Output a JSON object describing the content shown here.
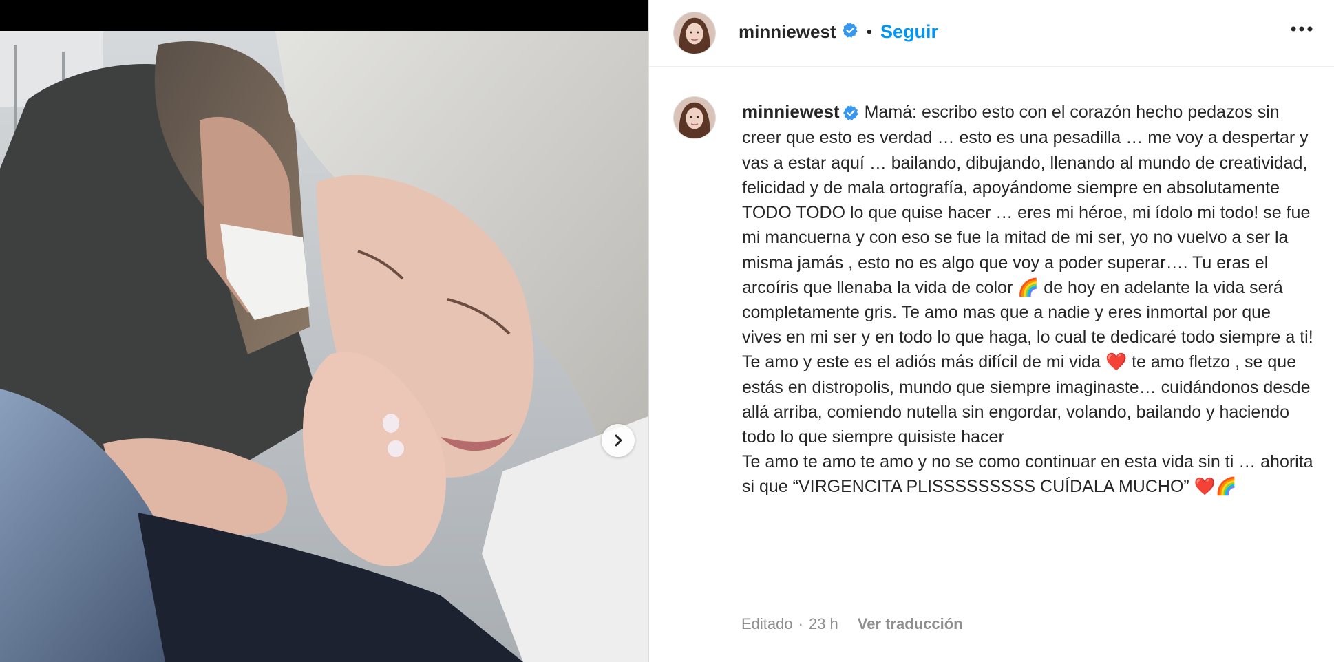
{
  "post": {
    "username": "minniewest",
    "follow_label": "Seguir",
    "separator": "•",
    "caption": "Mamá: escribo esto con el corazón hecho pedazos sin creer que esto es verdad … esto es una pesadilla … me voy a despertar y vas a estar aquí … bailando, dibujando, llenando al mundo de creatividad, felicidad y de mala ortografía, apoyándome siempre en absolutamente TODO TODO lo que quise hacer … eres mi héroe, mi ídolo mi todo! se fue mi mancuerna y con eso se fue la mitad de mi ser, yo no vuelvo a ser la misma jamás , esto no es algo que voy a poder superar…. Tu eras el arcoíris que llenaba la vida de color 🌈 de hoy en adelante la vida será completamente gris. Te amo mas que a nadie y eres inmortal por que vives en mi ser y en todo lo que haga, lo cual te dedicaré todo siempre a ti! Te amo y este es el adiós más difícil de mi vida ❤️ te amo fletzo , se que estás en distropolis, mundo que siempre imaginaste… cuidándonos desde allá arriba, comiendo nutella sin engordar, volando, bailando y haciendo todo lo que siempre quisiste hacer\nTe amo te amo te amo y no se como continuar en esta vida sin ti … ahorita si que “VIRGENCITA PLISSSSSSSSS CUÍDALA MUCHO” ❤️🌈",
    "edited_label": "Editado",
    "meta_separator": "·",
    "time_ago": "23 h",
    "translate_label": "Ver traducción"
  },
  "icons": {
    "verified": "verified-badge-icon",
    "more": "more-options-icon",
    "next": "chevron-right-icon"
  },
  "colors": {
    "link": "#0095f6",
    "verified": "#3897f0",
    "text": "#262626",
    "muted": "#8e8e8e"
  }
}
